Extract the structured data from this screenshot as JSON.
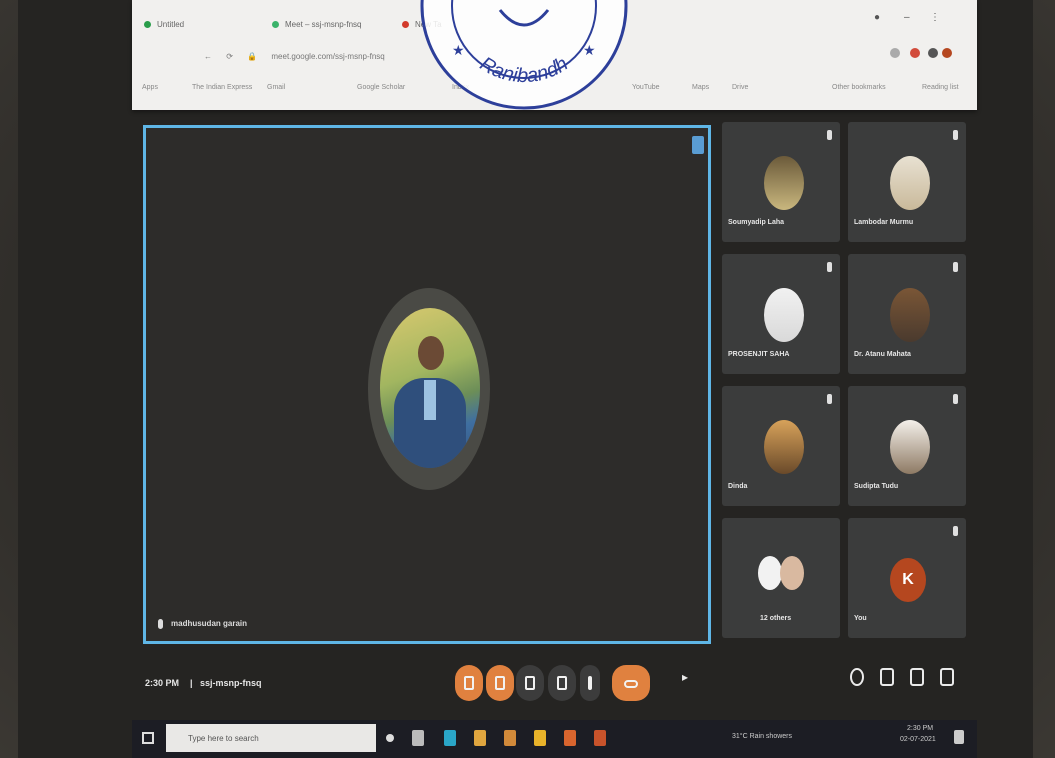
{
  "browser": {
    "tabs": [
      "Untitled",
      "Meet – ssj-msnp-fnsq",
      "New Tab"
    ],
    "address": "meet.google.com/ssj-msnp-fnsq",
    "bookmarks": [
      "Apps",
      "The Indian Express",
      "Gmail",
      "Google Scholar",
      "Inbox",
      "YouTube",
      "Maps",
      "Drive",
      "Other bookmarks",
      "Reading list"
    ]
  },
  "stamp": {
    "text": "Ranibandh"
  },
  "meet": {
    "main": {
      "name": "madhusudan garain"
    },
    "participants": [
      {
        "name": "Soumyadip Laha"
      },
      {
        "name": "Lambodar Murmu"
      },
      {
        "name": "PROSENJIT SAHA"
      },
      {
        "name": "Dr. Atanu Mahata"
      },
      {
        "name": "Dinda"
      },
      {
        "name": "Sudipta Tudu"
      },
      {
        "name": "12 others"
      },
      {
        "name": "You",
        "initial": "K"
      }
    ],
    "bottom": {
      "time": "2:30 PM",
      "meeting_code": "ssj-msnp-fnsq",
      "separator": "|"
    }
  },
  "taskbar": {
    "search_placeholder": "Type here to search",
    "clock_time": "2:30 PM",
    "clock_date": "02-07-2021",
    "tray_text": "31°C Rain showers"
  },
  "colors": {
    "active_border": "#5fb6e6",
    "control_orange": "#e0813f",
    "stamp_blue": "#2d3f9a"
  }
}
